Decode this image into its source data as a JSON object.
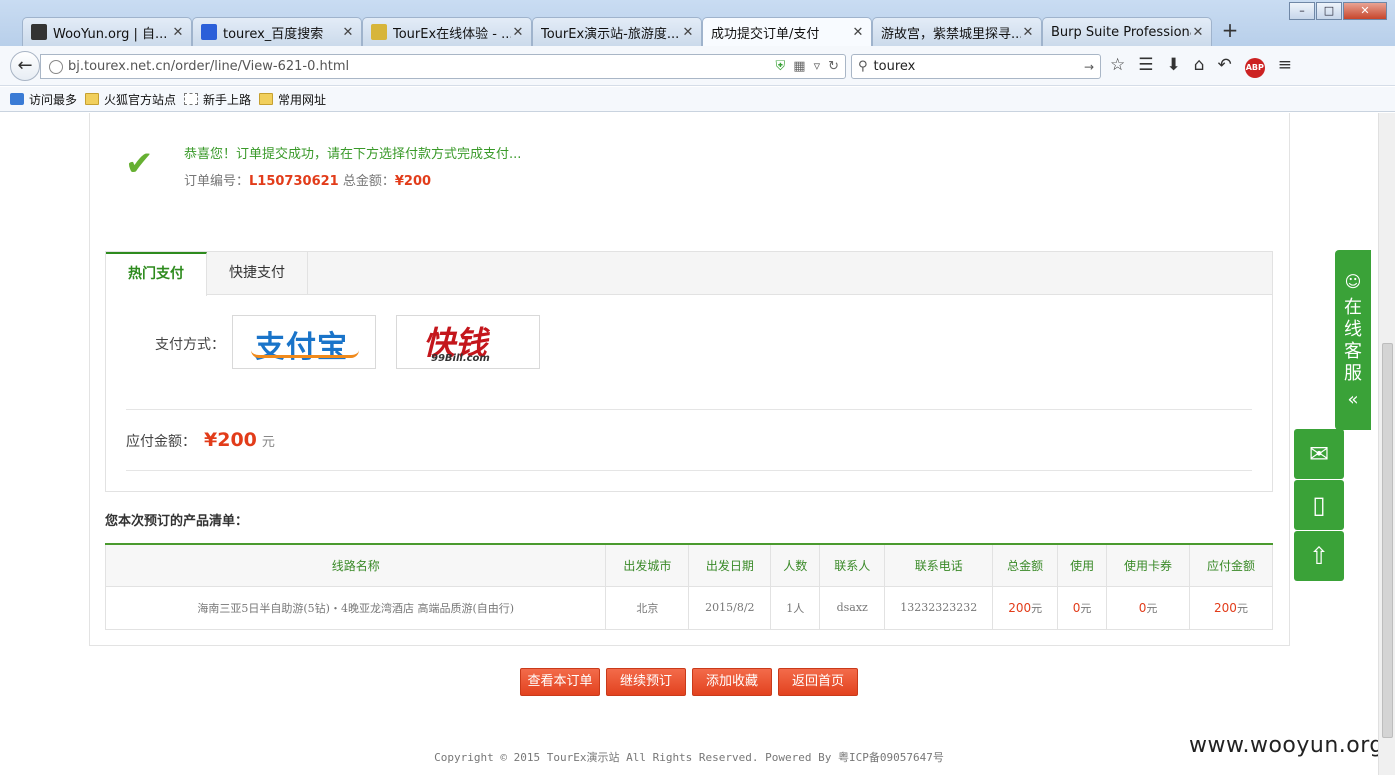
{
  "browser": {
    "tabs": [
      {
        "title": "WooYun.org | 自...",
        "icon_color": "#333333"
      },
      {
        "title": "tourex_百度搜索",
        "icon_color": "#2b5fd9"
      },
      {
        "title": "TourEx在线体验 - ...",
        "icon_color": "#d7b53a"
      },
      {
        "title": "TourEx演示站-旅游度...",
        "icon_color": ""
      },
      {
        "title": "成功提交订单/支付",
        "icon_color": ""
      },
      {
        "title": "游故宫，紫禁城里探寻...",
        "icon_color": ""
      },
      {
        "title": "Burp Suite Professional",
        "icon_color": ""
      }
    ],
    "active_tab": 4,
    "new_tab_label": "+",
    "url": "bj.tourex.net.cn/order/line/View-621-0.html",
    "search_value": "tourex",
    "bookmarks": [
      {
        "label": "访问最多",
        "icon": "blue"
      },
      {
        "label": "火狐官方站点",
        "icon": "folder"
      },
      {
        "label": "新手上路",
        "icon": "dash"
      },
      {
        "label": "常用网址",
        "icon": "folder"
      }
    ]
  },
  "success": {
    "message": "恭喜您！订单提交成功，请在下方选择付款方式完成支付...",
    "order_label": "订单编号：",
    "order_no": "L150730621",
    "total_label": "总金额：",
    "total": "¥200"
  },
  "payment": {
    "tabs": [
      "热门支付",
      "快捷支付"
    ],
    "active_tab": 0,
    "method_label": "支付方式：",
    "alipay_text": "支付宝",
    "kq_text": "快钱",
    "kq_sub": "99Bill.com",
    "due_label": "应付金额：",
    "due_amount": "¥200",
    "due_unit": "元"
  },
  "order_list": {
    "title": "您本次预订的产品清单：",
    "headers": [
      "线路名称",
      "出发城市",
      "出发日期",
      "人数",
      "联系人",
      "联系电话",
      "总金额",
      "使用",
      "使用卡券",
      "应付金额"
    ],
    "rows": [
      {
        "route": "海南三亚5日半自助游(5钻)・4晚亚龙湾酒店 高端品质游(自由行)",
        "city": "北京",
        "date": "2015/8/2",
        "people": "1人",
        "contact": "dsaxz",
        "phone": "13232323232",
        "total_num": "200",
        "use_num": "0",
        "coupon_num": "0",
        "due_num": "200",
        "unit": "元"
      }
    ]
  },
  "actions": [
    "查看本订单",
    "继续预订",
    "添加收藏",
    "返回首页"
  ],
  "customer_service": {
    "label": "在线客服",
    "collapse": "«"
  },
  "footer": "Copyright © 2015 TourEx演示站 All Rights Reserved. Powered By 粤ICP备09057647号",
  "watermark": "www.wooyun.org",
  "colors": {
    "accent_green": "#3aa238",
    "price_red": "#e23c1a",
    "button_orange": "#e2421f"
  }
}
